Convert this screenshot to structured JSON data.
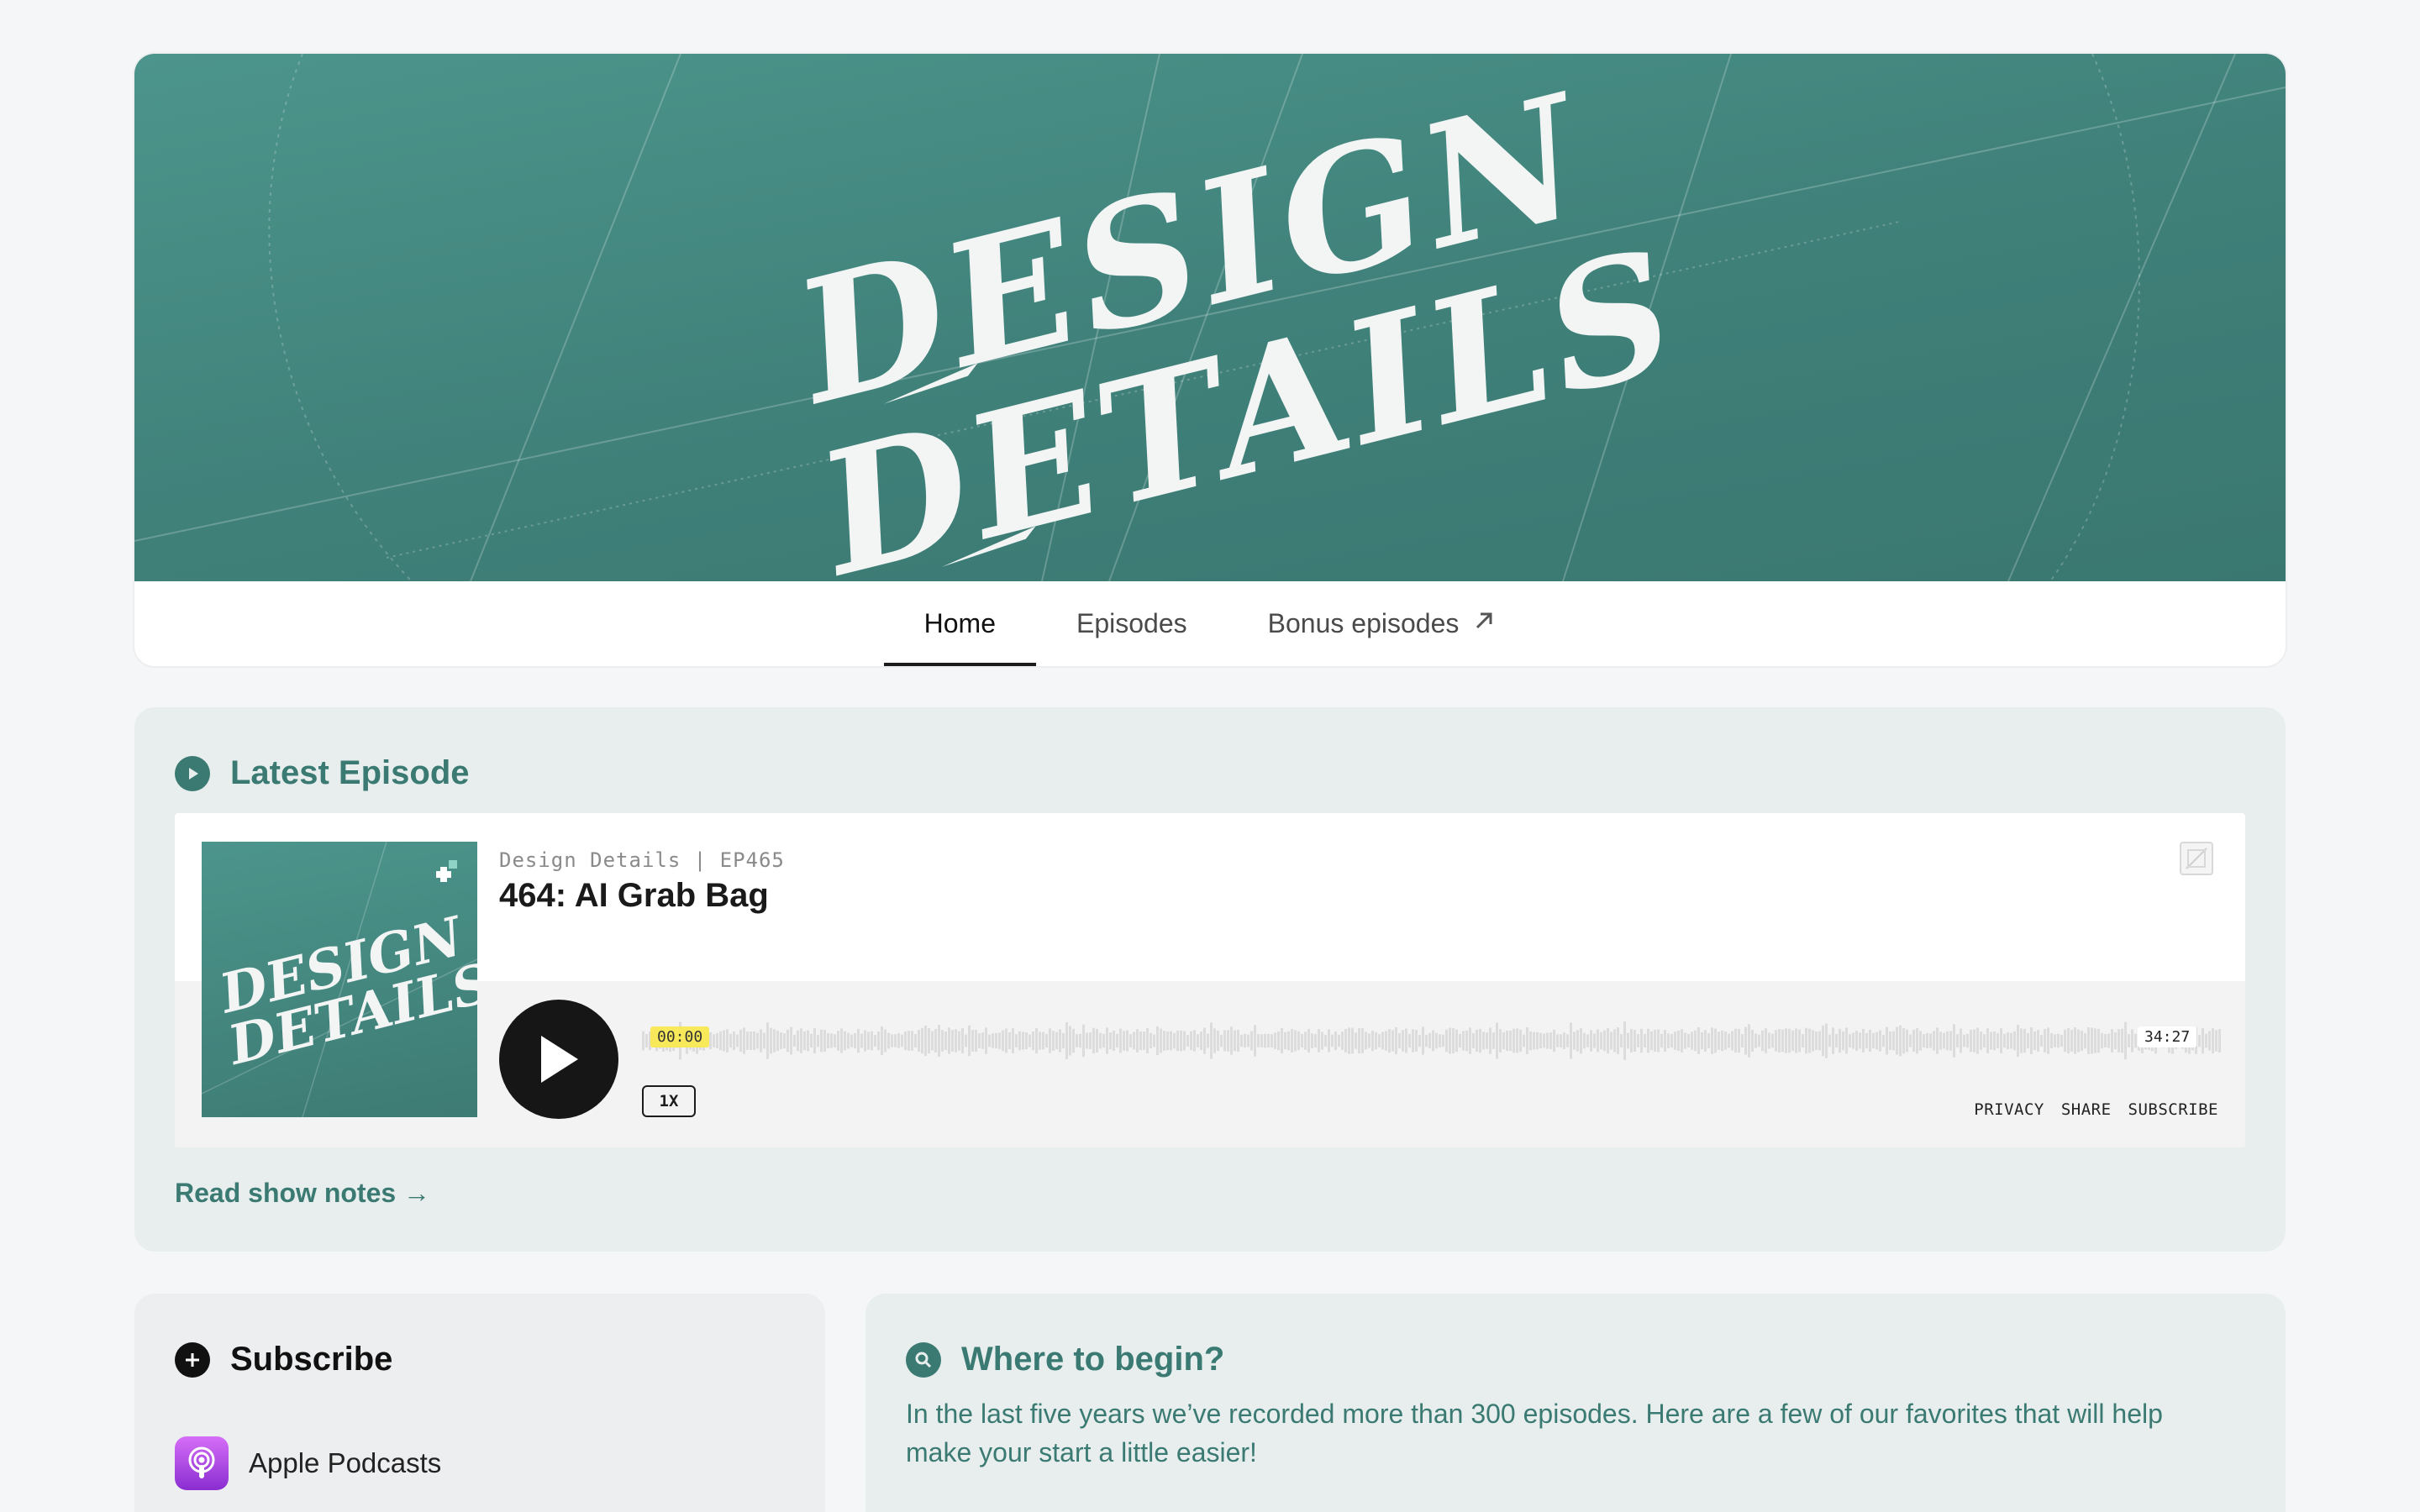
{
  "banner": {
    "logo_line1": "DESIGN",
    "logo_line2": "DETAILS"
  },
  "nav": {
    "tabs": [
      {
        "label": "Home",
        "active": true
      },
      {
        "label": "Episodes",
        "active": false
      },
      {
        "label": "Bonus episodes",
        "active": false,
        "external": true
      }
    ],
    "external_icon": "arrow-up-right-icon"
  },
  "latest": {
    "heading": "Latest Episode",
    "heading_icon": "play-circle-icon",
    "player": {
      "meta": "Design Details | EP465",
      "title": "464: AI Grab Bag",
      "cover_line1": "DESIGN",
      "cover_line2": "DETAILS",
      "time_current": "00:00",
      "time_total": "34:27",
      "progress": 0,
      "speed": "1X",
      "links": {
        "privacy": "PRIVACY",
        "share": "SHARE",
        "subscribe": "SUBSCRIBE"
      }
    },
    "show_notes_label": "Read show notes →"
  },
  "subscribe": {
    "heading": "Subscribe",
    "heading_icon": "plus-circle-icon",
    "items": [
      {
        "label": "Apple Podcasts",
        "icon": "apple-podcasts-icon"
      }
    ]
  },
  "where": {
    "heading": "Where to begin?",
    "heading_icon": "search-circle-icon",
    "body": "In the last five years we’ve recorded more than 300 episodes. Here are a few of our favorites that will help make your start a little easier!"
  },
  "colors": {
    "page_bg": "#f5f6f8",
    "teal": "#3b7a72",
    "banner": "#4c958c",
    "latest_bg": "#e7eeed",
    "time_highlight": "#f7e95a"
  }
}
